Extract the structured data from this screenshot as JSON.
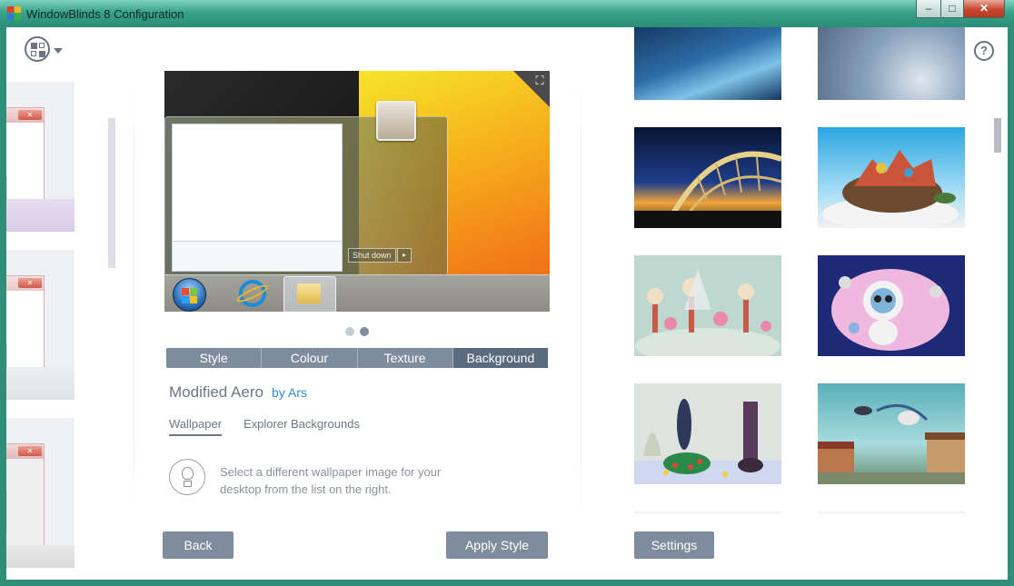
{
  "window": {
    "title": "WindowBlinds 8 Configuration",
    "controls": {
      "minimize": "–",
      "maximize": "□",
      "close": "✕"
    }
  },
  "toolbar": {
    "menu_icon": "grid-menu-icon",
    "search_icon": "search-icon",
    "settings_icon": "gear-icon",
    "help_icon": "help-icon",
    "help_glyph": "?"
  },
  "preview": {
    "shutdown_label": "Shut down",
    "shutdown_arrow": "▸",
    "fullscreen_glyph": "⛶",
    "page_count": 2,
    "active_page": 2
  },
  "tabs": [
    {
      "label": "Style"
    },
    {
      "label": "Colour"
    },
    {
      "label": "Texture"
    },
    {
      "label": "Background"
    }
  ],
  "active_tab": "Background",
  "theme": {
    "name": "Modified Aero",
    "author": "by Ars"
  },
  "subtabs": {
    "wallpaper": "Wallpaper",
    "explorer": "Explorer Backgrounds"
  },
  "hint": "Select a different wallpaper image for your desktop from the list on the right.",
  "buttons": {
    "back": "Back",
    "apply": "Apply Style",
    "settings": "Settings"
  },
  "colors": {
    "accent": "#7e8c9e",
    "active_tab": "#5b6b7f",
    "link": "#2d8fd5",
    "title_bar": "#3aa189"
  }
}
